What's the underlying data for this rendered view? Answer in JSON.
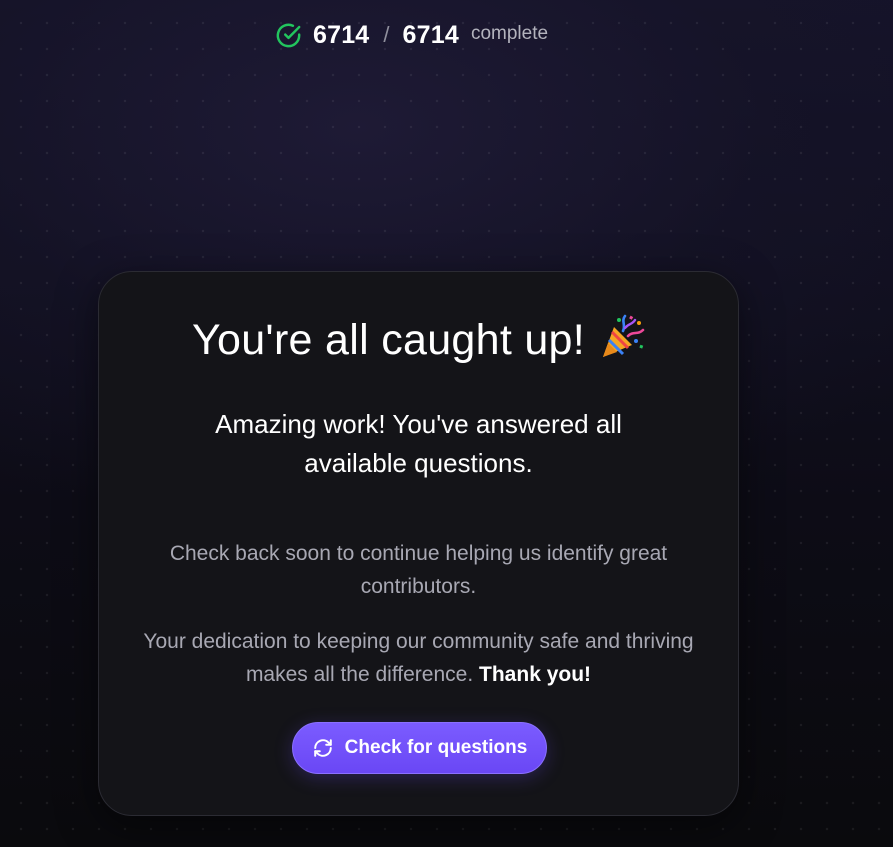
{
  "progress": {
    "done": "6714",
    "separator": "/",
    "total": "6714",
    "status_label": "complete",
    "icon": "check-circle-icon",
    "icon_color": "#22c55e"
  },
  "card": {
    "title": "You're all caught up!",
    "title_icon": "party-popper-icon",
    "subtitle": "Amazing work! You've answered all available questions.",
    "text1": "Check back soon to continue helping us identify great contributors.",
    "text2": "Your dedication to keeping our community safe and thriving makes all the difference.",
    "text2_emphasis": "Thank you!",
    "button": {
      "label": "Check for questions",
      "icon": "refresh-icon",
      "color": "#7057ff"
    }
  }
}
